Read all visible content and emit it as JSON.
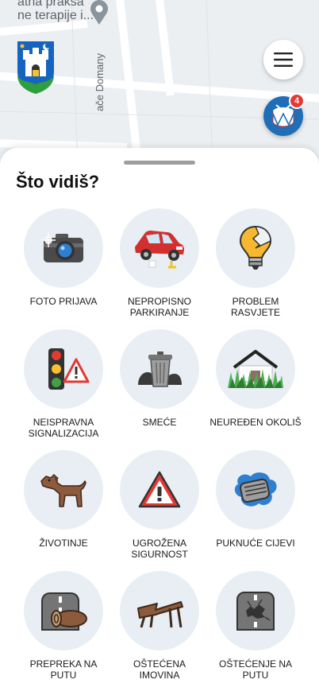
{
  "map": {
    "place_line_1": "atna praksa",
    "place_line_2": "ne terapije i...",
    "street_name": "ače Domany"
  },
  "header": {
    "menu_icon": "hamburger-menu-icon",
    "drum_icon": "drum-icon",
    "notification_count": "4",
    "accent_color": "#1e6fb8",
    "badge_color": "#e53935"
  },
  "sheet": {
    "title": "Što vidiš?",
    "categories": [
      {
        "label": "FOTO PRIJAVA",
        "icon": "camera-icon"
      },
      {
        "label": "NEPROPISNO PARKIRANJE",
        "icon": "wrong-parking-car-icon"
      },
      {
        "label": "PROBLEM RASVJETE",
        "icon": "broken-bulb-icon"
      },
      {
        "label": "NEISPRAVNA SIGNALIZACIJA",
        "icon": "traffic-light-warning-icon"
      },
      {
        "label": "SMEĆE",
        "icon": "trash-bin-icon"
      },
      {
        "label": "NEUREĐEN OKOLIŠ",
        "icon": "overgrown-grass-icon"
      },
      {
        "label": "ŽIVOTINJE",
        "icon": "dog-icon"
      },
      {
        "label": "UGROŽENA SIGURNOST",
        "icon": "warning-triangle-icon"
      },
      {
        "label": "PUKNUĆE CIJEVI",
        "icon": "burst-pipe-icon"
      },
      {
        "label": "PREPREKA NA PUTU",
        "icon": "road-obstacle-icon"
      },
      {
        "label": "OŠTEĆENA IMOVINA",
        "icon": "broken-bench-icon"
      },
      {
        "label": "OŠTEĆENJE NA PUTU",
        "icon": "road-damage-icon"
      }
    ]
  }
}
